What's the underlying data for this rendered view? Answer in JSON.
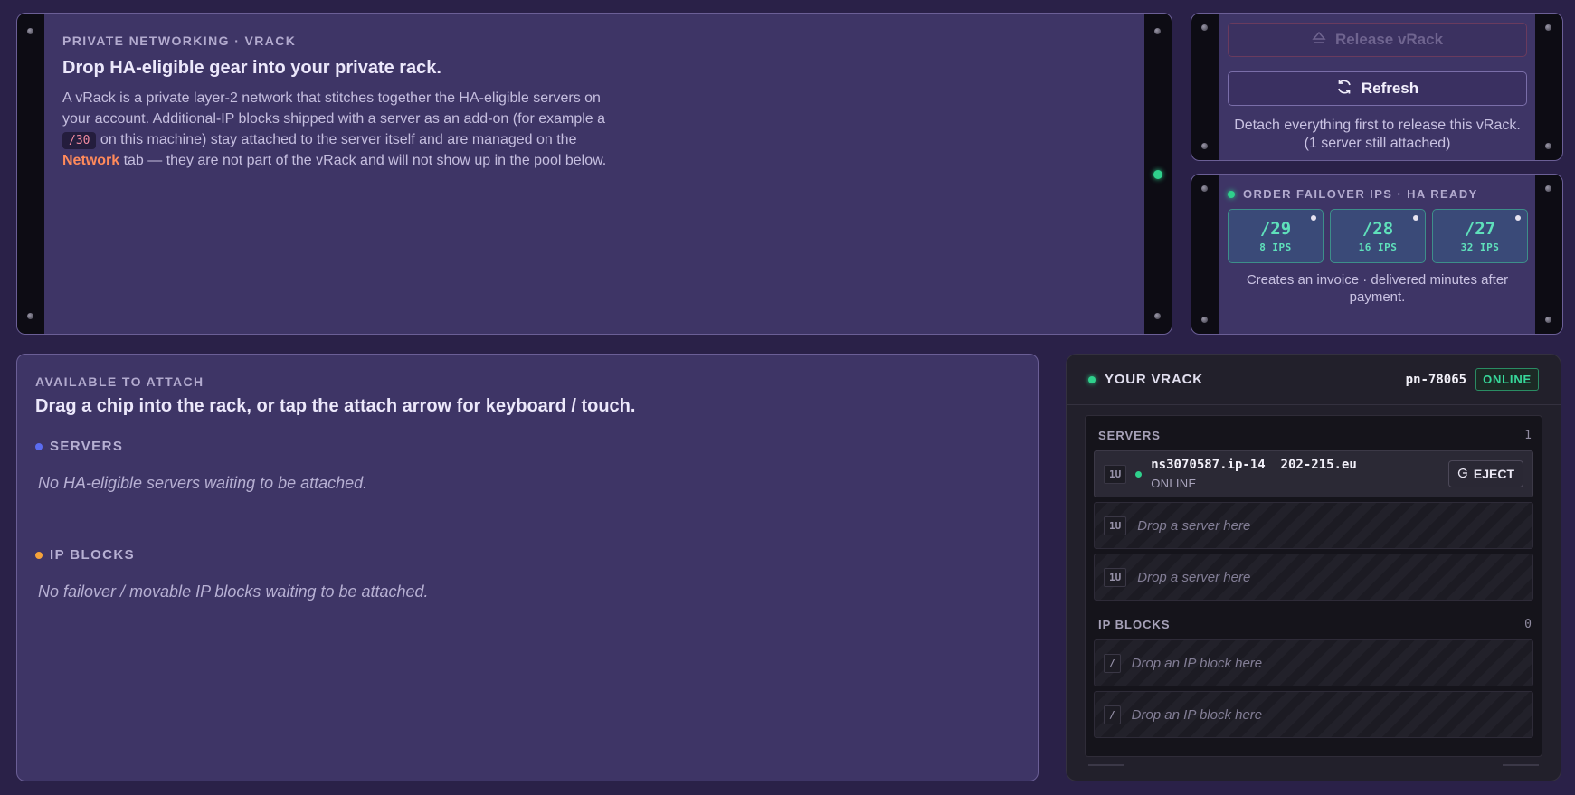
{
  "intro": {
    "eyebrow": "PRIVATE NETWORKING · VRACK",
    "headline": "Drop HA-eligible gear into your private rack.",
    "body_part1": "A vRack is a private layer-2 network that stitches together the HA-eligible servers on your account. Additional-IP blocks shipped with a server as an add-on (for example a ",
    "code": "/30",
    "body_part2": " on this machine) stay attached to the server itself and are managed on the ",
    "network_link": "Network",
    "body_part3": " tab — they are not part of the vRack and will not show up in the pool below."
  },
  "release": {
    "release_label": "Release vRack",
    "refresh_label": "Refresh",
    "note": "Detach everything first to release this vRack. (1 server still attached)"
  },
  "failover": {
    "title": "ORDER FAILOVER IPS · HA READY",
    "options": [
      {
        "cidr": "/29",
        "ips": "8 IPS"
      },
      {
        "cidr": "/28",
        "ips": "16 IPS"
      },
      {
        "cidr": "/27",
        "ips": "32 IPS"
      }
    ],
    "note": "Creates an invoice · delivered minutes after payment."
  },
  "available": {
    "eyebrow": "AVAILABLE TO ATTACH",
    "headline": "Drag a chip into the rack, or tap the attach arrow for keyboard / touch.",
    "servers_label": "SERVERS",
    "servers_empty": "No HA-eligible servers waiting to be attached.",
    "ipblocks_label": "IP BLOCKS",
    "ipblocks_empty": "No failover / movable IP blocks waiting to be attached."
  },
  "vrack": {
    "title": "YOUR VRACK",
    "id": "pn-78065",
    "status": "ONLINE",
    "servers_label": "SERVERS",
    "servers_count": "1",
    "server": {
      "u": "1U",
      "name": "ns3070587.ip-14  202-215.eu",
      "status": "ONLINE",
      "eject_label": "EJECT"
    },
    "server_slots": [
      {
        "u": "1U",
        "text": "Drop a server here"
      },
      {
        "u": "1U",
        "text": "Drop a server here"
      }
    ],
    "ipblocks_label": "IP BLOCKS",
    "ipblocks_count": "0",
    "ip_slots": [
      {
        "tag": "/",
        "text": "Drop an IP block here"
      },
      {
        "tag": "/",
        "text": "Drop an IP block here"
      }
    ]
  },
  "colors": {
    "background": "#2a2148",
    "panel": "#3e3566",
    "accent_green": "#2fd08c",
    "servers_bullet": "#5b6cf0",
    "ipblocks_bullet": "#f5a23a",
    "network_link": "#ff8a5b"
  },
  "icons": {
    "release": "eject-icon",
    "refresh": "refresh-icon",
    "eject": "eject-circle-icon"
  }
}
